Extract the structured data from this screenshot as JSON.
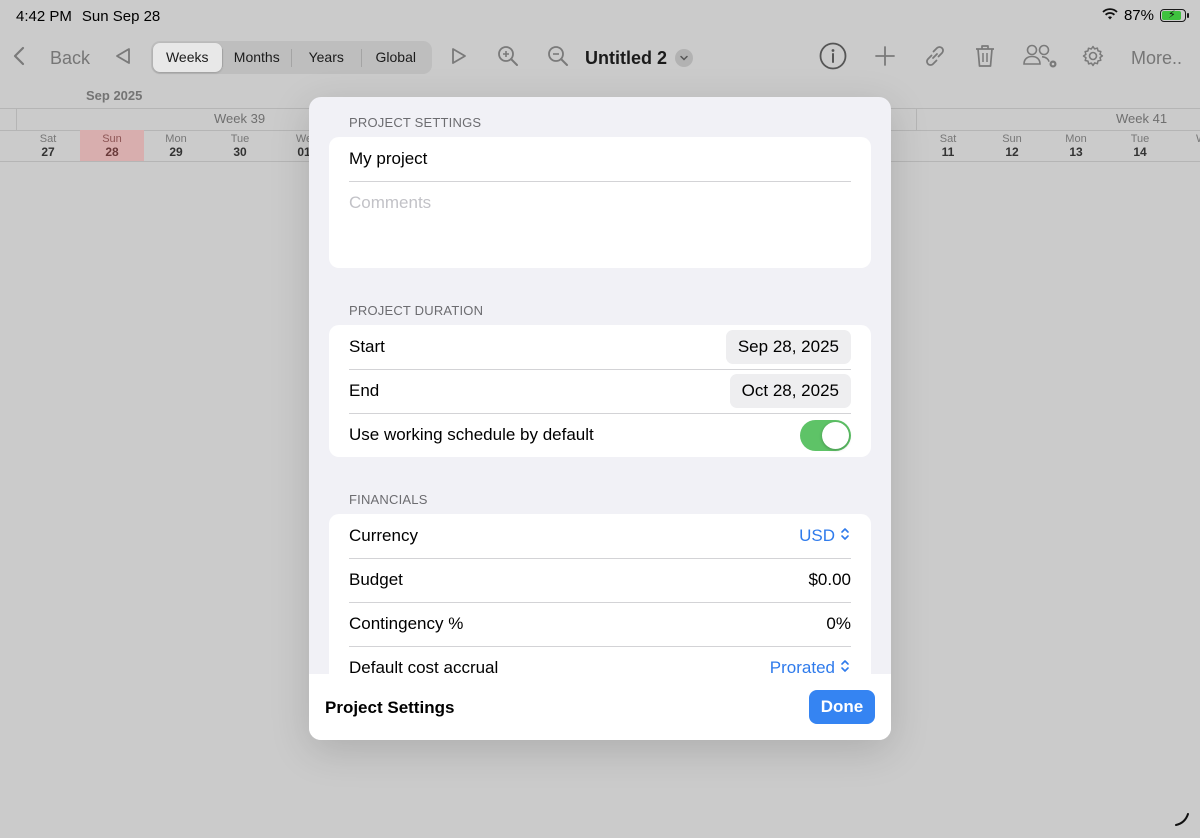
{
  "status": {
    "time": "4:42 PM",
    "date": "Sun Sep 28",
    "battery": "87%"
  },
  "toolbar": {
    "back_label": "Back",
    "segments": [
      "Weeks",
      "Months",
      "Years",
      "Global"
    ],
    "active_segment": "Weeks",
    "title": "Untitled 2",
    "more_label": "More.."
  },
  "calendar": {
    "month": "Sep 2025",
    "weeks": [
      "Week 39",
      "Week 41"
    ],
    "days_left": [
      {
        "name": "Sat",
        "num": "27"
      },
      {
        "name": "Sun",
        "num": "28"
      },
      {
        "name": "Mon",
        "num": "29"
      },
      {
        "name": "Tue",
        "num": "30"
      },
      {
        "name": "We",
        "num": "01"
      }
    ],
    "days_right": [
      {
        "name": "Sat",
        "num": "11"
      },
      {
        "name": "Sun",
        "num": "12"
      },
      {
        "name": "Mon",
        "num": "13"
      },
      {
        "name": "Tue",
        "num": "14"
      },
      {
        "name": "W",
        "num": ""
      }
    ]
  },
  "modal": {
    "settings_header": "PROJECT SETTINGS",
    "project_name": "My project",
    "comments_placeholder": "Comments",
    "duration_header": "PROJECT DURATION",
    "start_label": "Start",
    "start_value": "Sep 28, 2025",
    "end_label": "End",
    "end_value": "Oct 28, 2025",
    "schedule_label": "Use working schedule by default",
    "schedule_on": true,
    "financials_header": "FINANCIALS",
    "currency_label": "Currency",
    "currency_value": "USD",
    "budget_label": "Budget",
    "budget_value": "$0.00",
    "contingency_label": "Contingency %",
    "contingency_value": "0%",
    "accrual_label": "Default cost accrual",
    "accrual_value": "Prorated",
    "footer_title": "Project Settings",
    "done_label": "Done"
  },
  "colors": {
    "accent": "#3584f2",
    "toggle_on": "#5ec367",
    "today": "#d8aeae"
  }
}
